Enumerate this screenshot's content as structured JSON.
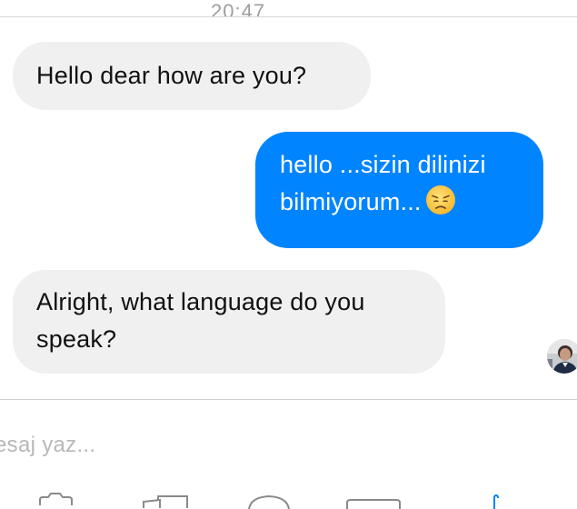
{
  "thread": {
    "timestamp": "20:47",
    "messages": [
      {
        "sender": "them",
        "text": "Hello dear how are you?"
      },
      {
        "sender": "me",
        "lines": [
          "hello ...sizin dilinizi",
          "bilmiyorum..."
        ],
        "emoji": "disappointed-face-icon"
      },
      {
        "sender": "them",
        "lines": [
          "Alright, what language do you",
          "speak?"
        ]
      }
    ],
    "seen_avatar": "avatar"
  },
  "composer": {
    "placeholder": "esaj yaz...",
    "toolbar_icons": [
      "camera-icon",
      "gallery-icon",
      "sticker-icon",
      "gif-icon",
      "mic-icon"
    ]
  },
  "colors": {
    "outgoing_bubble": "#0084ff",
    "incoming_bubble": "#f0f0f0",
    "placeholder_text": "#b8b8b8",
    "accent": "#0084ff"
  }
}
